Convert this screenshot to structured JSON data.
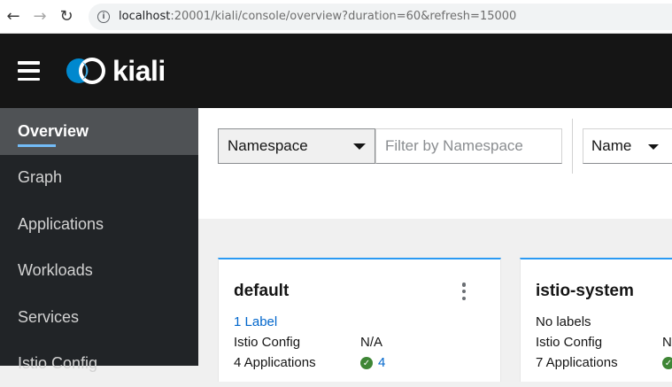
{
  "browser": {
    "url_host": "localhost",
    "url_path": ":20001/kiali/console/overview?duration=60&refresh=15000"
  },
  "masthead": {
    "logo_text": "kiali"
  },
  "sidebar": {
    "items": [
      {
        "label": "Overview",
        "active": true
      },
      {
        "label": "Graph"
      },
      {
        "label": "Applications"
      },
      {
        "label": "Workloads"
      },
      {
        "label": "Services"
      },
      {
        "label": "Istio Config"
      }
    ]
  },
  "toolbar": {
    "filter_type": "Namespace",
    "filter_placeholder": "Filter by Namespace",
    "sort_by": "Name"
  },
  "cards": [
    {
      "title": "default",
      "labels": "1 Label",
      "istio_config_label": "Istio Config",
      "istio_config_value": "N/A",
      "applications_label": "4 Applications",
      "applications_healthy": "4"
    },
    {
      "title": "istio-system",
      "labels": "No labels",
      "istio_config_label": "Istio Config",
      "istio_config_value": "N/A",
      "applications_label": "7 Applications",
      "applications_healthy": ""
    }
  ],
  "colors": {
    "masthead_bg": "#151515",
    "sidebar_bg": "#212427",
    "accent": "#2b9af3",
    "link": "#0066cc",
    "healthy": "#3e8635"
  }
}
